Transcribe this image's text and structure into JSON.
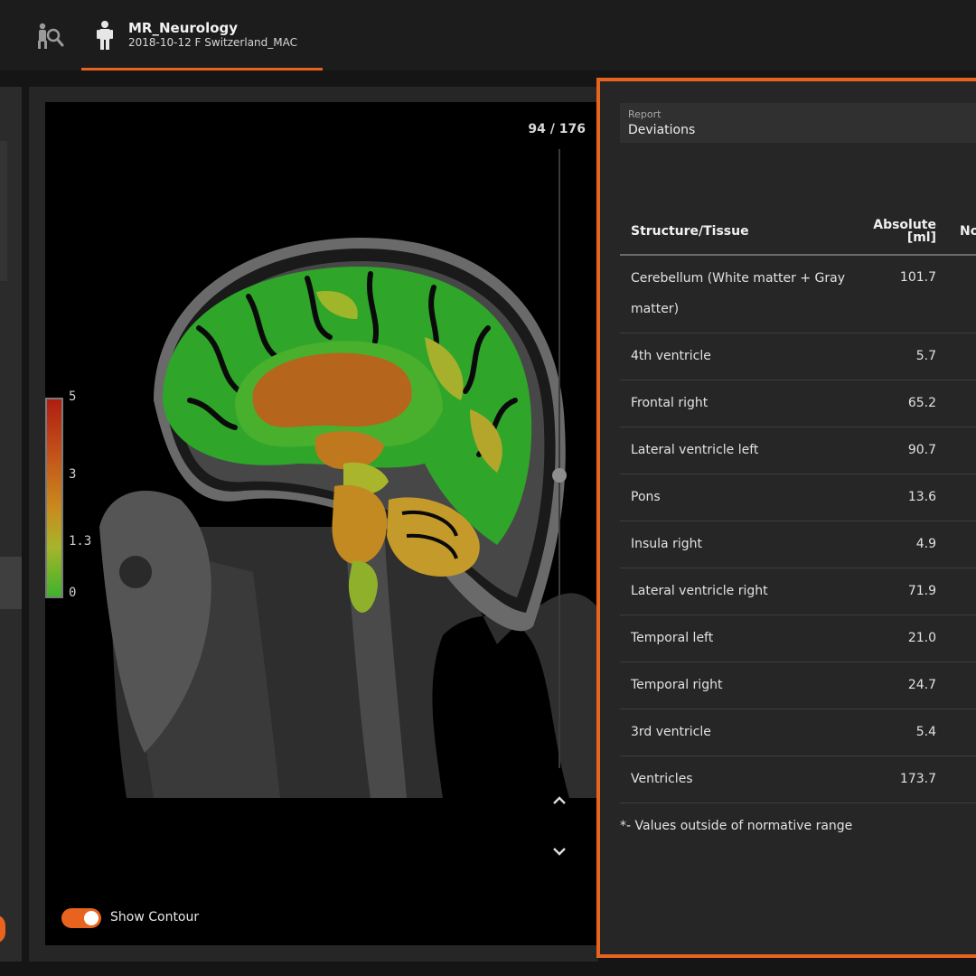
{
  "header": {
    "patient_name": "MR_Neurology",
    "patient_info": "2018-10-12 F Switzerland_MAC"
  },
  "viewer": {
    "slice_counter": "94 / 176",
    "colorbar_labels": [
      "5",
      "3",
      "1.3",
      "0"
    ],
    "show_contour_label": "Show Contour",
    "show_contour_on": true
  },
  "report": {
    "select_caption": "Report",
    "select_value": "Deviations",
    "columns": {
      "structure": "Structure/Tissue",
      "absolute": "Absolute",
      "absolute_unit": "[ml]",
      "normalized": "No"
    },
    "rows": [
      {
        "structure": "Cerebellum (White matter + Gray matter)",
        "absolute": "101.7"
      },
      {
        "structure": "4th ventricle",
        "absolute": "5.7"
      },
      {
        "structure": "Frontal right",
        "absolute": "65.2"
      },
      {
        "structure": "Lateral ventricle left",
        "absolute": "90.7"
      },
      {
        "structure": "Pons",
        "absolute": "13.6"
      },
      {
        "structure": "Insula right",
        "absolute": "4.9"
      },
      {
        "structure": "Lateral ventricle right",
        "absolute": "71.9"
      },
      {
        "structure": "Temporal left",
        "absolute": "21.0"
      },
      {
        "structure": "Temporal right",
        "absolute": "24.7"
      },
      {
        "structure": "3rd ventricle",
        "absolute": "5.4"
      },
      {
        "structure": "Ventricles",
        "absolute": "173.7"
      }
    ],
    "footnote": "*- Values outside of normative range"
  },
  "colors": {
    "accent": "#e8641e",
    "background": "#151515",
    "panel": "#262626"
  },
  "icons": {
    "patient_search": "patient-search-icon",
    "person": "person-icon",
    "chevron_up": "chevron-up-icon",
    "chevron_down": "chevron-down-icon"
  }
}
